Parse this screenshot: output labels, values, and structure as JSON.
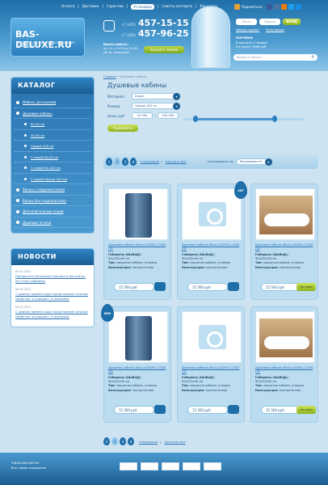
{
  "header": {
    "nav": [
      "Оплата",
      "Доставка",
      "Гарантии",
      "Установка",
      "Советы эксперта",
      "Контакты"
    ],
    "nav_active_index": 3,
    "logo_text": "BAS-DELUXE.RU",
    "logo_sub": "ИНТЕРНЕТ-МАГАЗИН ДУШЕВЫХ КАБИН САНТЕХНИКИ",
    "phones": [
      {
        "code": "+7 (495)",
        "number": "457-15-15"
      },
      {
        "code": "+7 (495)",
        "number": "457-96-25"
      }
    ],
    "hours_title": "Время работы:",
    "hours_weekdays": "пн.-чт. с 9:00 до 21:00",
    "hours_weekend": "сб.-вс. выходной",
    "order_call": "Заказать звонок",
    "share": "Поделиться…",
    "login_placeholder": "Логин",
    "password_placeholder": "Пароль",
    "login_button": "ВХОД",
    "forgot": "Забыли пароль?",
    "register": "Регистрация",
    "cart_title": "КОРЗИНА",
    "cart_text": "В корзине 2 товара",
    "cart_sum": "на сумму 2568 руб",
    "search_placeholder": "Введите запрос..."
  },
  "sidebar": {
    "catalog_title": "КАТАЛОГ",
    "items": [
      {
        "label": "Мебель для ванной",
        "level": 0
      },
      {
        "label": "Душевые кабины",
        "level": 0
      },
      {
        "label": "80-84 см",
        "level": 1
      },
      {
        "label": "90-95 см",
        "level": 1
      },
      {
        "label": "Свыше 100 см",
        "level": 1
      },
      {
        "label": "С парой 80-84 см",
        "level": 1
      },
      {
        "label": "С парой 90-100 см",
        "level": 1
      },
      {
        "label": "С парой свыше 100 см",
        "level": 1
      },
      {
        "label": "Ванны с гидромассажем",
        "level": 0
      },
      {
        "label": "Ванны без гидромассажа",
        "level": 0
      },
      {
        "label": "Дополнительные опции",
        "level": 0
      },
      {
        "label": "Душевые уголки",
        "level": 0
      }
    ],
    "news_title": "НОВОСТИ",
    "news": [
      {
        "date": "09.02.2012",
        "text": "Прекратите вечерние поездки в магазины, не стоит забывать"
      },
      {
        "date": "09.02.2012",
        "text": "С давних времён вода представляет многие свойства: и очищает, и освежает"
      },
      {
        "date": "09.02.2012",
        "text": "С давних времён вода представляет многие свойства: и очищает, и освежает"
      }
    ]
  },
  "main": {
    "breadcrumb_home": "Главная",
    "breadcrumb_current": "Душевые кабины",
    "title": "Душевые кабины",
    "filters": {
      "material_label": "Материал:",
      "material_value": "Акрил",
      "size_label": "Размер:",
      "size_value": "Свыше 100 см",
      "price_label": "Цена, руб:",
      "price_from": "10 000",
      "price_to": "100 000",
      "range_low": 0.1,
      "range_high": 0.75,
      "apply": "Применить"
    },
    "pagination": {
      "pages": [
        "1",
        "2",
        "3",
        "4"
      ],
      "current_index": 1,
      "next": "следующая",
      "show_all": "показать все",
      "sort_label": "Сортировать по:",
      "sort_value": "Популярности"
    },
    "products": [
      {
        "name": "Душевая кабина Attua A-8296-1 CWS L/R",
        "spec1": "Габариты (ШхВхД):",
        "spec1v": "90х225х90 см",
        "spec2": "Тип:",
        "spec2v": "закрытая кабина, угловая",
        "spec3": "Конструкция:",
        "spec3v": "полностенная",
        "price": "15 560 руб",
        "image": "shower",
        "badge": "",
        "action": "buy"
      },
      {
        "name": "Душевая кабина Attua A-8296-1 CWS L/R",
        "spec1": "Габариты (ШхВхД):",
        "spec1v": "90х225х90 см",
        "spec2": "Тип:",
        "spec2v": "закрытая кабина, угловая",
        "spec3": "Конструкция:",
        "spec3v": "полностенная",
        "price": "15 560 руб",
        "image": "photo-placeholder",
        "badge": "ХИТ",
        "action": "buy"
      },
      {
        "name": "Душевая кабина Attua A-8296-1 CWS L/R",
        "spec1": "Габариты (ШхВхД):",
        "spec1v": "90х225х90 см",
        "spec2": "Тип:",
        "spec2v": "закрытая кабина, угловая",
        "spec3": "Конструкция:",
        "spec3v": "полностенная",
        "price": "15 560 руб",
        "image": "bathtub",
        "badge": "",
        "action": "order",
        "order_label": "На заказ"
      },
      {
        "name": "Душевая кабина Attua A-8296-1 CWS L/R",
        "spec1": "Габариты (ШхВхД):",
        "spec1v": "90х225х90 см",
        "spec2": "Тип:",
        "spec2v": "закрытая кабина, угловая",
        "spec3": "Конструкция:",
        "spec3v": "полностенная",
        "price": "15 560 руб",
        "image": "shower",
        "badge": "NEW",
        "action": "buy"
      },
      {
        "name": "Душевая кабина Attua A-8296-1 CWS L/R",
        "spec1": "Габариты (ШхВхД):",
        "spec1v": "90х225х90 см",
        "spec2": "Тип:",
        "spec2v": "закрытая кабина, угловая",
        "spec3": "Конструкция:",
        "spec3v": "полностенная",
        "price": "15 560 руб",
        "image": "photo-placeholder",
        "badge": "",
        "action": "buy"
      },
      {
        "name": "Душевая кабина Attua A-8296-1 CWS L/R",
        "spec1": "Габариты (ШхВхД):",
        "spec1v": "90х225х90 см",
        "spec2": "Тип:",
        "spec2v": "закрытая кабина, угловая",
        "spec3": "Конструкция:",
        "spec3v": "полностенная",
        "price": "15 560 руб",
        "image": "bathtub",
        "badge": "",
        "action": "order",
        "order_label": "На заказ"
      }
    ]
  },
  "footer": {
    "copyright": "©BAS-DELUXE.RU",
    "rights": "Все права защищены"
  },
  "colors": {
    "brand_blue": "#1f6ea8",
    "accent_green": "#8bb21c",
    "link": "#2973b8"
  }
}
